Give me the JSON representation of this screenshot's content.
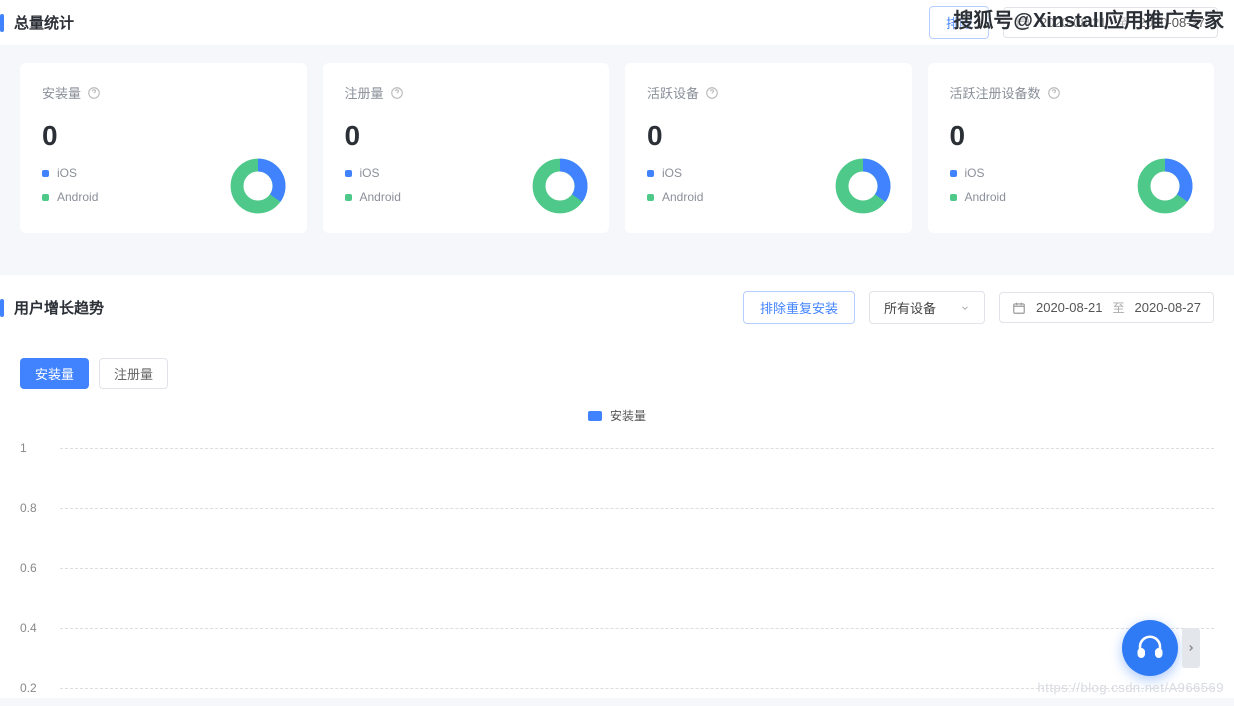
{
  "watermark_top": "搜狐号@Xinstall应用推广专家",
  "watermark_bottom": "https://blog.csdn.net/A966569",
  "section_total": {
    "title": "总量统计",
    "exclude_btn": "排除",
    "date_start": "2020-08-21",
    "date_sep": "至",
    "date_end": "2020-08-27",
    "cards": [
      {
        "title": "安装量",
        "value": "0",
        "legend_ios": "iOS",
        "legend_android": "Android"
      },
      {
        "title": "注册量",
        "value": "0",
        "legend_ios": "iOS",
        "legend_android": "Android"
      },
      {
        "title": "活跃设备",
        "value": "0",
        "legend_ios": "iOS",
        "legend_android": "Android"
      },
      {
        "title": "活跃注册设备数",
        "value": "0",
        "legend_ios": "iOS",
        "legend_android": "Android"
      }
    ]
  },
  "section_trend": {
    "title": "用户增长趋势",
    "exclude_btn": "排除重复安装",
    "device_select": "所有设备",
    "date_start": "2020-08-21",
    "date_sep": "至",
    "date_end": "2020-08-27",
    "tab_install": "安装量",
    "tab_register": "注册量",
    "chart_legend": "安装量"
  },
  "chart_data": {
    "type": "line",
    "title": "",
    "xlabel": "",
    "ylabel": "",
    "ylim": [
      0.2,
      1
    ],
    "yticks": [
      1,
      0.8,
      0.6,
      0.4,
      0.2
    ],
    "series": [
      {
        "name": "安装量",
        "values": []
      }
    ],
    "categories": []
  }
}
